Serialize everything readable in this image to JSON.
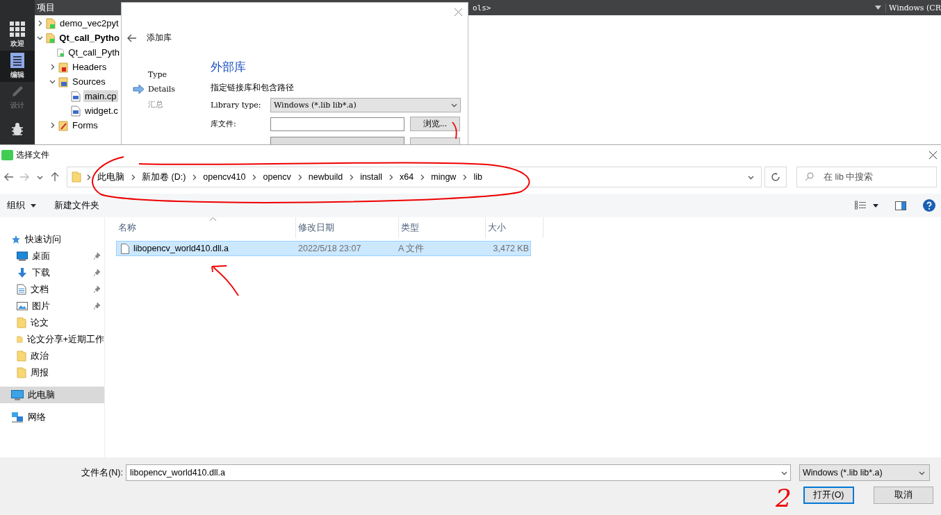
{
  "ide": {
    "panel_title": "项目",
    "toolbar_text": "ols>",
    "kit_text": "Windows (CR",
    "modes": [
      {
        "kind": "welcome",
        "label": "欢迎",
        "selected": false,
        "disabled": false
      },
      {
        "kind": "edit",
        "label": "编辑",
        "selected": true,
        "disabled": false
      },
      {
        "kind": "design",
        "label": "设计",
        "selected": false,
        "disabled": true
      },
      {
        "kind": "debug",
        "selected": false,
        "disabled": false
      }
    ],
    "tree": [
      {
        "kind": "project",
        "label": "demo_vec2pyt",
        "active": false,
        "expanded": false,
        "selected": false
      },
      {
        "kind": "project",
        "label": "Qt_call_Pytho",
        "active": true,
        "expanded": true,
        "selected": false,
        "children": [
          {
            "kind": "pro-file",
            "label": "Qt_call_Pyth",
            "active": false,
            "selected": false
          },
          {
            "kind": "headers",
            "label": "Headers",
            "active": false,
            "expanded": false,
            "selected": false
          },
          {
            "kind": "sources",
            "label": "Sources",
            "active": false,
            "expanded": true,
            "selected": false,
            "children": [
              {
                "kind": "cpp",
                "label": "main.cp",
                "active": false,
                "selected": true
              },
              {
                "kind": "cpp",
                "label": "widget.c",
                "active": false,
                "selected": false
              }
            ]
          },
          {
            "kind": "forms",
            "label": "Forms",
            "active": false,
            "expanded": false,
            "selected": false
          }
        ]
      }
    ]
  },
  "add_library": {
    "title": "添加库",
    "steps": [
      {
        "label": "Type",
        "current": false,
        "disabled": false
      },
      {
        "label": "Details",
        "current": true,
        "disabled": false
      },
      {
        "label": "汇总",
        "current": false,
        "disabled": true
      }
    ],
    "heading": "外部库",
    "subtitle": "指定链接库和包含路径",
    "library_type": {
      "label": "Library type:",
      "value": "Windows (*.lib lib*.a)"
    },
    "library_file": {
      "label": "库文件:",
      "button": "浏览..."
    }
  },
  "file_dialog": {
    "title": "选择文件",
    "path": [
      "此电脑",
      "新加卷 (D:)",
      "opencv410",
      "opencv",
      "newbuild",
      "install",
      "x64",
      "mingw",
      "lib"
    ],
    "search": {
      "placeholder": "在 lib 中搜索"
    },
    "toolbar": [
      {
        "label": "组织",
        "menu": true
      },
      {
        "label": "新建文件夹",
        "menu": false
      }
    ],
    "nav": [
      {
        "kind": "quick-access",
        "label": "快速访问",
        "selected": false,
        "pinned": false,
        "children": [
          {
            "kind": "desktop",
            "label": "桌面",
            "selected": false,
            "pinned": true
          },
          {
            "kind": "downloads",
            "label": "下载",
            "selected": false,
            "pinned": true
          },
          {
            "kind": "documents",
            "label": "文档",
            "selected": false,
            "pinned": true
          },
          {
            "kind": "pictures",
            "label": "图片",
            "selected": false,
            "pinned": true
          },
          {
            "kind": "folder",
            "label": "论文",
            "selected": false,
            "pinned": false
          },
          {
            "kind": "folder",
            "label": "论文分享+近期工作",
            "selected": false,
            "pinned": false
          },
          {
            "kind": "folder",
            "label": "政治",
            "selected": false,
            "pinned": false
          },
          {
            "kind": "folder",
            "label": "周报",
            "selected": false,
            "pinned": false
          }
        ]
      },
      {
        "kind": "pc",
        "label": "此电脑",
        "selected": true,
        "pinned": false
      },
      {
        "kind": "network",
        "label": "网络",
        "selected": false,
        "pinned": false
      }
    ],
    "columns": [
      "名称",
      "修改日期",
      "类型",
      "大小"
    ],
    "rows": [
      {
        "name": "libopencv_world410.dll.a",
        "modified": "2022/5/18 23:07",
        "type": "A 文件",
        "size": "3,472 KB",
        "selected": true
      }
    ],
    "file_name": {
      "label": "文件名(N):",
      "value": "libopencv_world410.dll.a"
    },
    "filter": "Windows (*.lib lib*.a)",
    "buttons": [
      {
        "label": "打开(O)",
        "default": true
      },
      {
        "label": "取消",
        "default": false
      }
    ]
  },
  "annotations": [
    {
      "kind": "ellipse"
    },
    {
      "kind": "arrow"
    },
    {
      "kind": "stroke"
    },
    {
      "kind": "text",
      "text": "2"
    }
  ]
}
